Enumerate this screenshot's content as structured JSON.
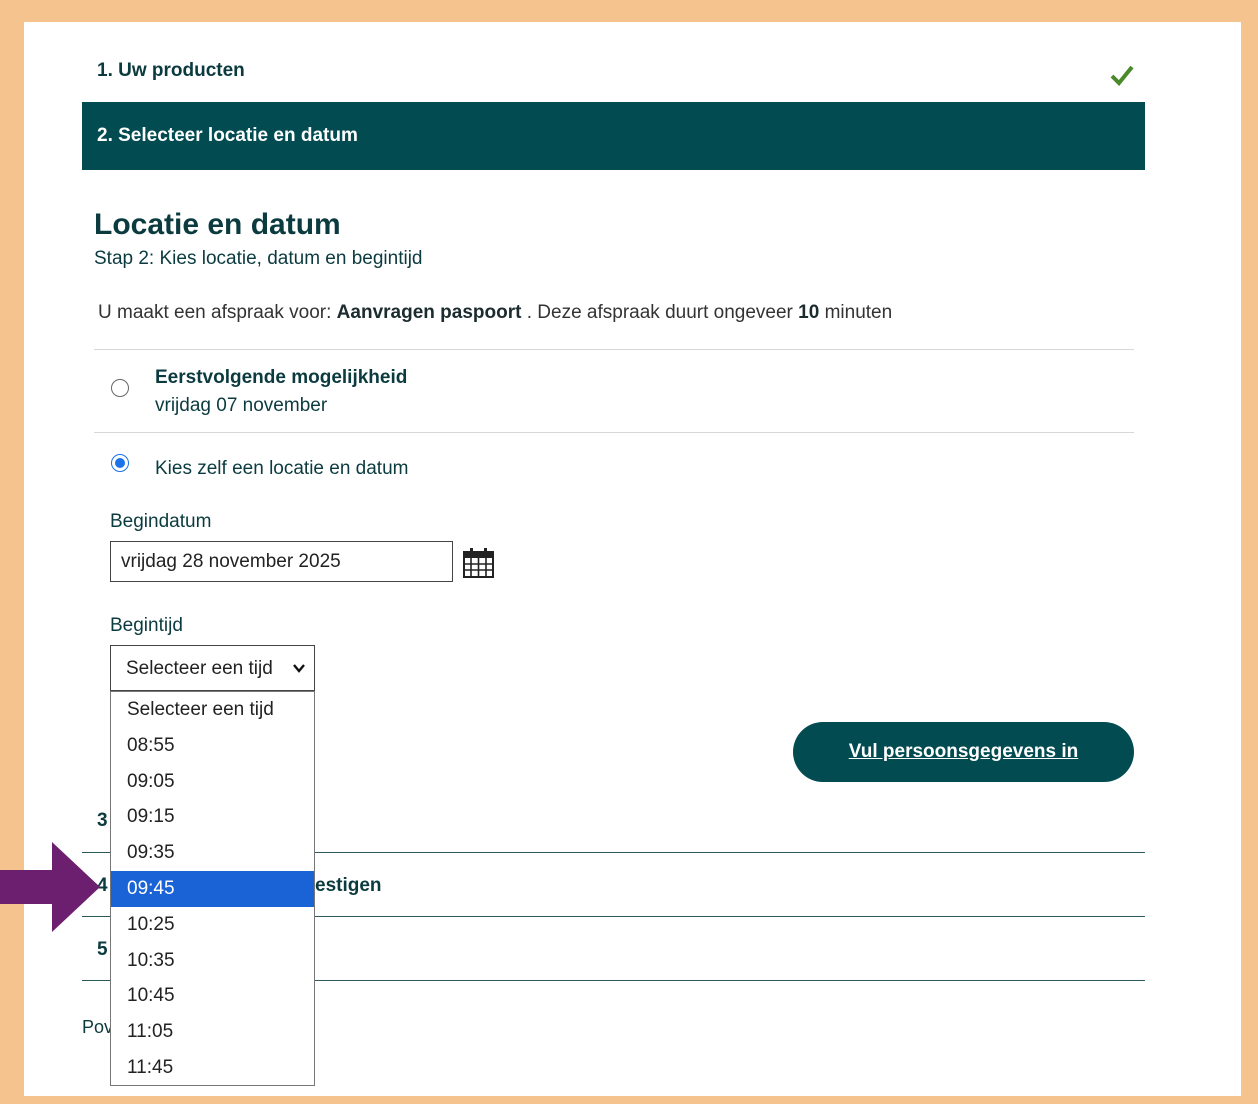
{
  "steps": {
    "step1": "1. Uw producten",
    "step2": "2. Selecteer locatie en datum",
    "step3_partial": "3",
    "step4_partial": "4",
    "step4_tail": "estigen",
    "step5_partial": "5"
  },
  "section": {
    "title": "Locatie en datum",
    "subtitle": "Stap 2: Kies locatie, datum en begintijd"
  },
  "info": {
    "prefix": "U maakt een afspraak voor:",
    "product": "Aanvragen paspoort",
    "middle": ". Deze afspraak duurt ongeveer",
    "minutes": "10",
    "suffix": "minuten"
  },
  "options": {
    "first_title": "Eerstvolgende mogelijkheid",
    "first_date": "vrijdag 07 november",
    "own_choice": "Kies zelf een locatie en datum"
  },
  "form": {
    "date_label": "Begindatum",
    "date_value": "vrijdag 28 november 2025",
    "time_label": "Begintijd",
    "time_selected": "Selecteer een tijd"
  },
  "dropdown": {
    "items": [
      "Selecteer een tijd",
      "08:55",
      "09:05",
      "09:15",
      "09:35",
      "09:45",
      "10:25",
      "10:35",
      "10:45",
      "11:05",
      "11:45"
    ],
    "highlighted": "09:45"
  },
  "cta": {
    "label": "Vul persoonsgegevens in"
  },
  "footer": {
    "partial": "Pov"
  },
  "colors": {
    "frame": "#f5c48e",
    "primary": "#014b51",
    "highlight": "#1a63d6",
    "arrow": "#6b1f6e",
    "check": "#4a8a2a"
  },
  "icons": [
    "check-icon",
    "calendar-icon",
    "chevron-down-icon",
    "pointer-arrow-icon"
  ]
}
